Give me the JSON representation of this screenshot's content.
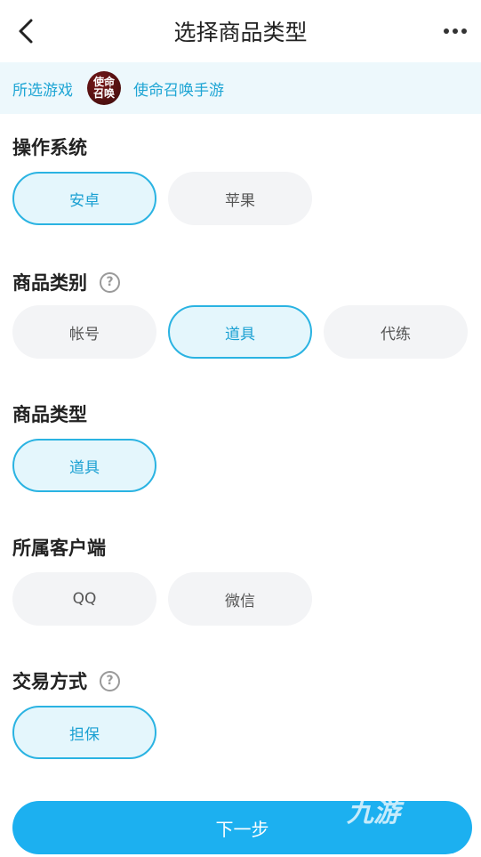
{
  "header": {
    "title": "选择商品类型"
  },
  "game": {
    "label": "所选游戏",
    "logo_line1": "使命",
    "logo_line2": "召唤",
    "name": "使命召唤手游"
  },
  "sections": {
    "os": {
      "title": "操作系统",
      "options": [
        "安卓",
        "苹果"
      ],
      "selected": "安卓"
    },
    "category": {
      "title": "商品类别",
      "options": [
        "帐号",
        "道具",
        "代练"
      ],
      "selected": "道具"
    },
    "type": {
      "title": "商品类型",
      "options": [
        "道具"
      ],
      "selected": "道具"
    },
    "client": {
      "title": "所属客户端",
      "options": [
        "QQ",
        "微信"
      ],
      "selected": ""
    },
    "trade": {
      "title": "交易方式",
      "options": [
        "担保"
      ],
      "selected": "担保"
    }
  },
  "help_glyph": "?",
  "next_button": "下一步",
  "watermark": "九游",
  "colors": {
    "accent": "#1cb0f0",
    "selected_border": "#2ab3e2",
    "selected_bg": "#e4f6fc",
    "game_bar_bg": "#edf8fc"
  }
}
